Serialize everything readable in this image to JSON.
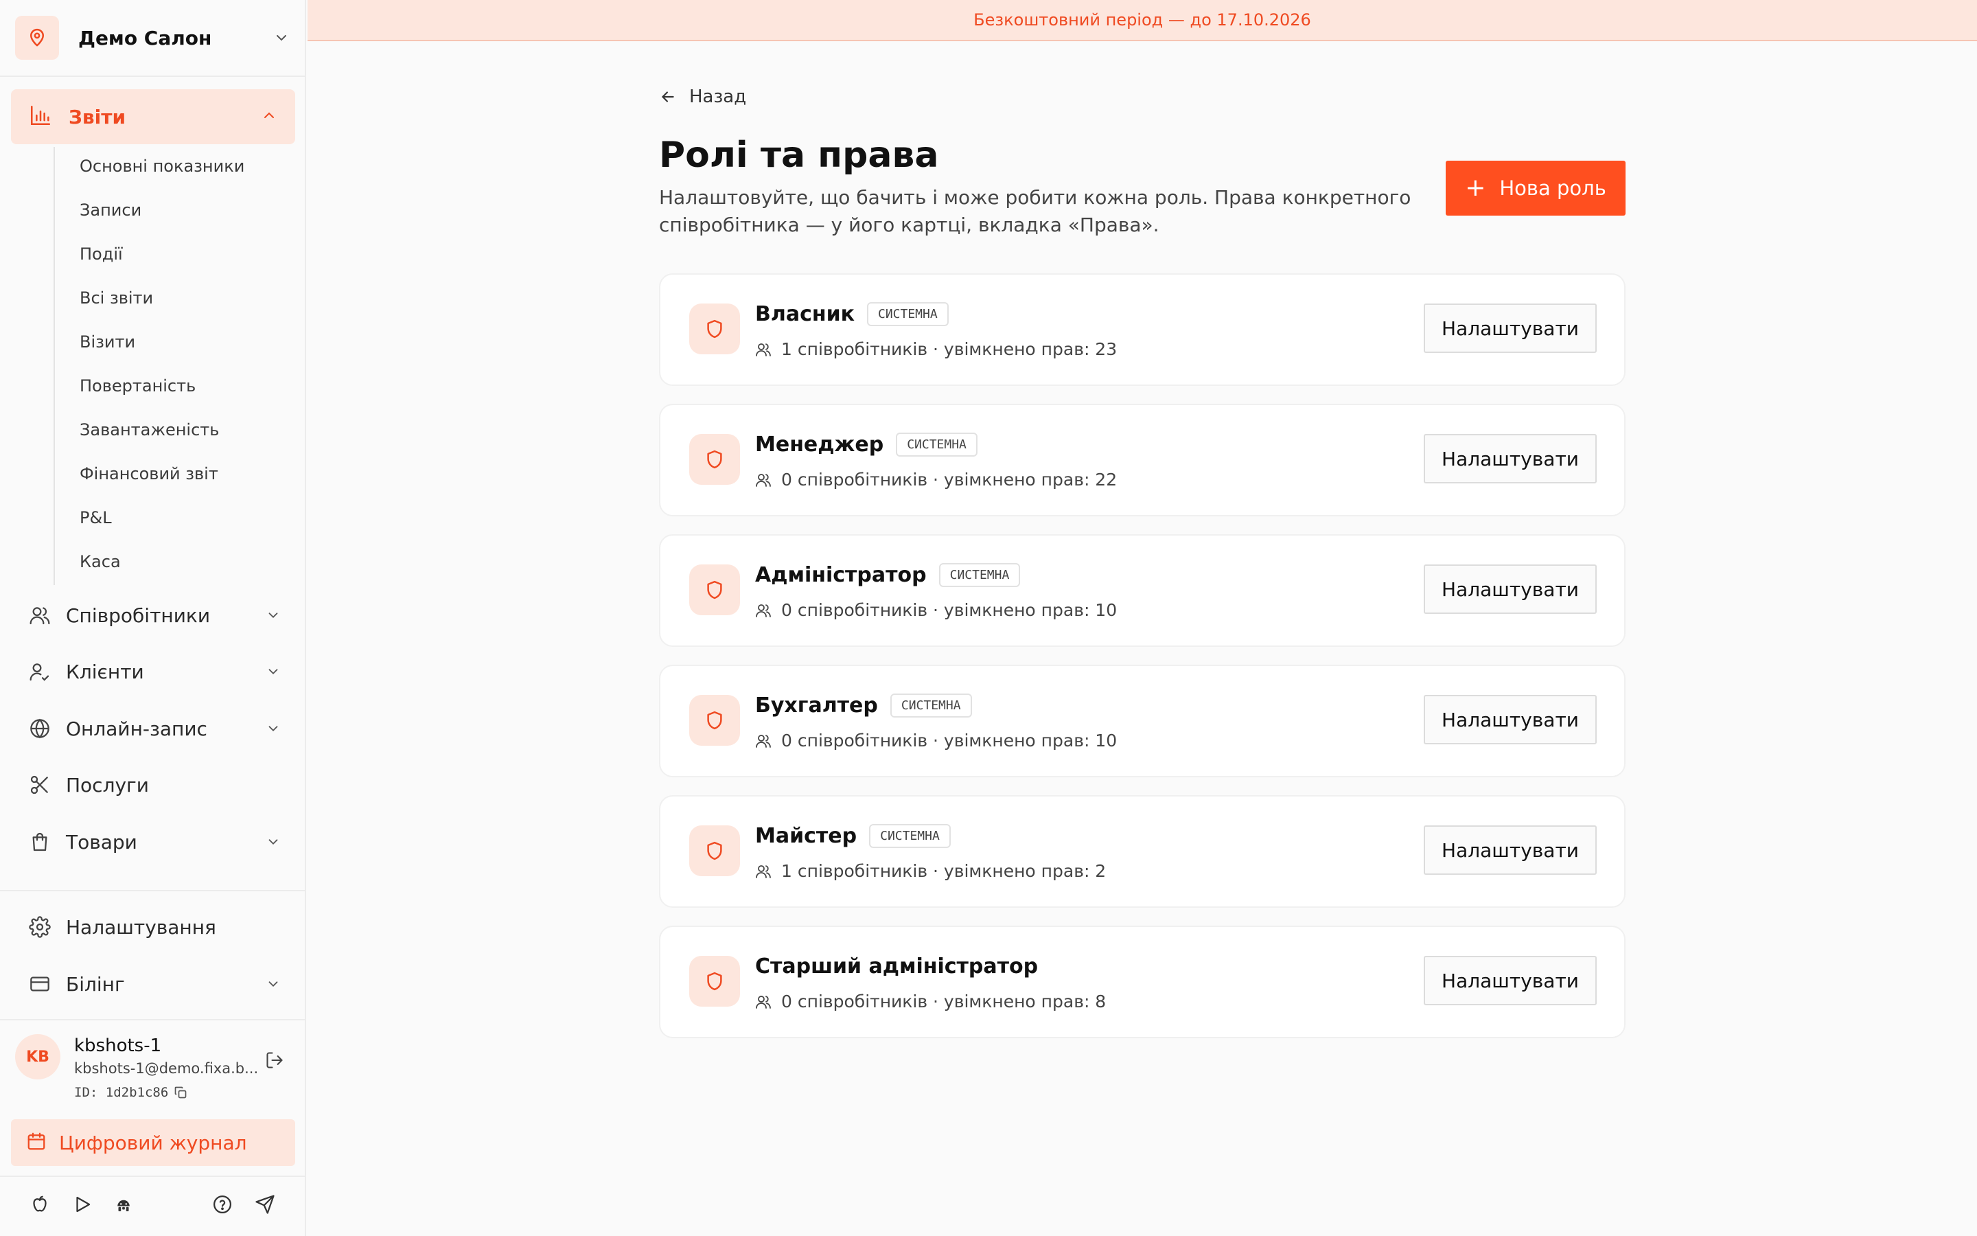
{
  "colors": {
    "accent": "#ff4f1f",
    "accent_text": "#ef4a21",
    "accent_light": "#fde6dd"
  },
  "trial_banner": "Безкоштовний період — до 17.10.2026",
  "sidebar": {
    "salon_name": "Демо Салон",
    "reports": {
      "label": "Звіти",
      "icon": "bar-chart-icon",
      "subitems": [
        "Основні показники",
        "Записи",
        "Події",
        "Всі звіти",
        "Візити",
        "Повертаність",
        "Завантаженість",
        "Фінансовий звіт",
        "P&L",
        "Каса"
      ]
    },
    "nav": [
      {
        "label": "Співробітники",
        "icon": "users-icon",
        "expandable": true
      },
      {
        "label": "Клієнти",
        "icon": "user-check-icon",
        "expandable": true
      },
      {
        "label": "Онлайн-запис",
        "icon": "globe-icon",
        "expandable": true
      },
      {
        "label": "Послуги",
        "icon": "scissors-icon",
        "expandable": false
      },
      {
        "label": "Товари",
        "icon": "shopping-bag-icon",
        "expandable": true
      }
    ],
    "settings_label": "Налаштування",
    "billing_label": "Білінг",
    "user": {
      "initials": "KB",
      "name": "kbshots-1",
      "email": "kbshots-1@demo.fixa.b...",
      "id": "ID: 1d2b1c86"
    },
    "journal_label": "Цифровий журнал",
    "bottom_icons": [
      "apple-icon",
      "play-icon",
      "android-icon",
      "help-icon",
      "send-icon"
    ]
  },
  "main": {
    "back_label": "Назад",
    "title": "Ролі та права",
    "description": "Налаштовуйте, що бачить і може робити кожна роль. Права конкретного співробітника — у його картці, вкладка «Права».",
    "new_role_label": "Нова роль",
    "configure_label": "Налаштувати",
    "roles": [
      {
        "name": "Власник",
        "badge": "СИСТЕМНА",
        "meta": "1 співробітників · увімкнено прав: 23"
      },
      {
        "name": "Менеджер",
        "badge": "СИСТЕМНА",
        "meta": "0 співробітників · увімкнено прав: 22"
      },
      {
        "name": "Адміністратор",
        "badge": "СИСТЕМНА",
        "meta": "0 співробітників · увімкнено прав: 10"
      },
      {
        "name": "Бухгалтер",
        "badge": "СИСТЕМНА",
        "meta": "0 співробітників · увімкнено прав: 10"
      },
      {
        "name": "Майстер",
        "badge": "СИСТЕМНА",
        "meta": "1 співробітників · увімкнено прав: 2"
      },
      {
        "name": "Старший адміністратор",
        "badge": "",
        "meta": "0 співробітників · увімкнено прав: 8"
      }
    ]
  }
}
